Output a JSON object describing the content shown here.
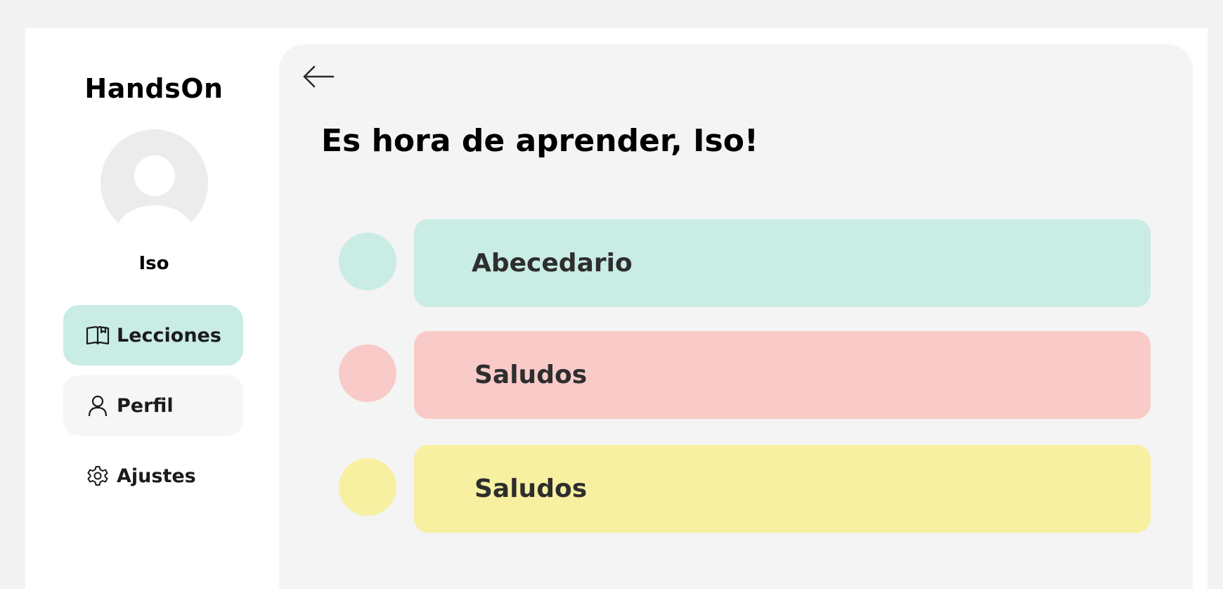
{
  "app": {
    "brand": "HandsOn"
  },
  "user": {
    "name": "Iso"
  },
  "sidebar": {
    "items": [
      {
        "label": "Lecciones",
        "icon": "book-icon",
        "active": true
      },
      {
        "label": "Perfil",
        "icon": "user-icon",
        "active": false
      },
      {
        "label": "Ajustes",
        "icon": "gear-icon",
        "active": false
      }
    ]
  },
  "main": {
    "back_icon": "arrow-left-icon",
    "title": "Es hora de aprender, Iso!",
    "lessons": [
      {
        "label": "Abecedario",
        "color": "#c9ece4"
      },
      {
        "label": "Saludos",
        "color": "#f8cbc8"
      },
      {
        "label": "Saludos",
        "color": "#f7f0a1"
      }
    ]
  },
  "colors": {
    "active_nav": "#c9ece4",
    "panel_bg": "#f4f4f4",
    "avatar_bg": "#ececec"
  }
}
